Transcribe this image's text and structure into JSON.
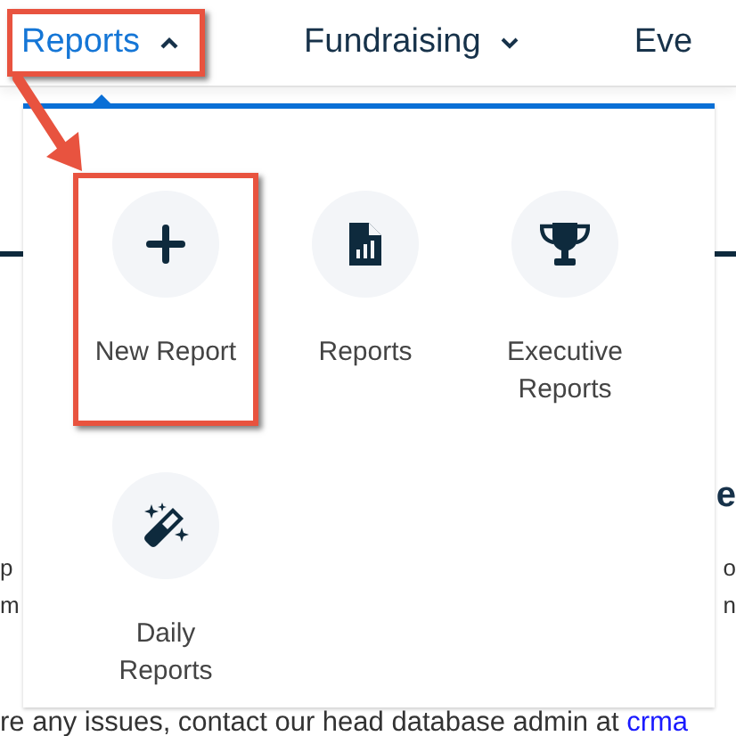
{
  "nav": [
    {
      "label": "Reports",
      "selected": true,
      "expanded": true,
      "highlighted": true
    },
    {
      "label": "Fundraising",
      "selected": false,
      "expanded": false,
      "highlighted": false
    },
    {
      "label": "Eve",
      "selected": false,
      "highlighted": false
    }
  ],
  "menu": {
    "items": [
      {
        "label": "New Report",
        "highlighted": true
      },
      {
        "label": "Reports",
        "highlighted": false
      },
      {
        "label": "Executive Reports",
        "highlighted": false
      },
      {
        "label": "Daily Reports",
        "highlighted": false
      }
    ]
  },
  "callout_arrow": true,
  "background": {
    "heading_fragment": "e",
    "left_fragments": [
      "p",
      "m"
    ],
    "right_fragments": [
      "o",
      "n"
    ],
    "notice": "re any issues, contact our head database admin at ",
    "notice_link": "crma"
  }
}
